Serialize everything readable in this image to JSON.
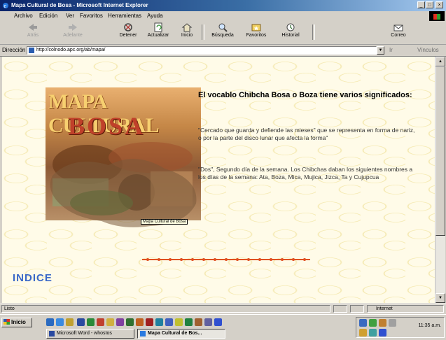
{
  "window": {
    "title": "Mapa Cultural de Bosa - Microsoft Internet Explorer"
  },
  "menu": [
    "Archivo",
    "Edición",
    "Ver",
    "Favoritos",
    "Herramientas",
    "Ayuda"
  ],
  "toolbar": {
    "back": "Atrás",
    "forward": "Adelante",
    "stop": "Detener",
    "refresh": "Actualizar",
    "home": "Inicio",
    "search": "Búsqueda",
    "favorites": "Favoritos",
    "history": "Historial",
    "mail": "Correo"
  },
  "address": {
    "label": "Dirección",
    "url": "http://colnodo.apc.org/ab/mapa/",
    "go": "Ir",
    "links": "Vínculos"
  },
  "page": {
    "image_title": "MAPA CULTURAL",
    "image_subtitle": "BOSA",
    "image_tooltip": "Mapa Cultural de Bosa",
    "heading": "El vocablo Chibcha Bosa o Boza tiene varios significados:",
    "para1": "\"Cercado que guarda y defiende las mieses\" que se representa en forma de nariz, o por la parte del disco lunar que afecta la forma\"",
    "para2": "\"Dos\", Segundo día de la semana. Los Chibchas daban los siguientes nombres a los días de la semana: Ata, Boza, Mica, Mujica, Jizca, Ta y Cujupcua",
    "indice": "INDICE"
  },
  "status": {
    "left": "Listo",
    "zone": "Internet"
  },
  "taskbar": {
    "start": "Inicio",
    "tasks": [
      "Microsoft Word - whostos",
      "Mapa Cultural de Bos..."
    ],
    "clock": "11:35 a.m."
  },
  "colors": {
    "title_bar": "#0a246a",
    "indice": "#3a68c8",
    "divider": "#e05020",
    "page_bg": "#fffbe8"
  }
}
